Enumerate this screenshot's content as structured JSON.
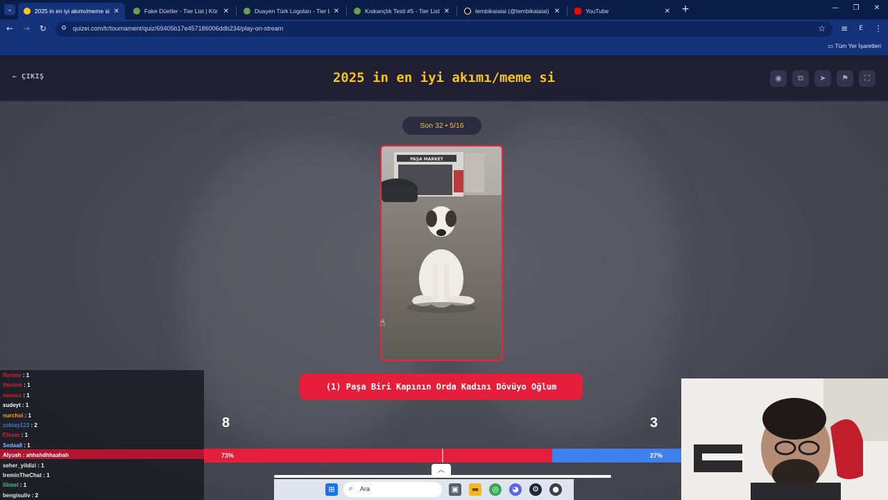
{
  "browser": {
    "tabs": [
      {
        "title": "2025 in en iyi akımı/meme si - ",
        "active": true,
        "favicon_color": "#f5c518"
      },
      {
        "title": "Fake Düetler - Tier List | Kör Sır",
        "active": false,
        "favicon_color": "#8fb3ff"
      },
      {
        "title": "Duayen Türk Logoları - Tier List",
        "active": false,
        "favicon_color": "#8fb3ff"
      },
      {
        "title": "Kıskançlık Testi #5 - Tier List, Kö",
        "active": false,
        "favicon_color": "#8fb3ff"
      },
      {
        "title": "tembikaiaiai (@tembikaiaiai) | T",
        "active": false,
        "favicon_color": "#111111"
      },
      {
        "title": "YouTube",
        "active": false,
        "favicon_color": "#ff0000"
      }
    ],
    "url": "quizei.com/tr/tournament/quiz/69405b17e457186006ddb234/play-on-stream",
    "bookmarks_all": "Tüm Yer İşaretleri",
    "profile_initial": "E"
  },
  "page": {
    "exit_label": "ÇIKIŞ",
    "title": "2025 in en iyi akımı/meme si",
    "round_label": "Son 32 • 5/16",
    "choice_label": "(1) Paşa Biri Kapının Orda Kadını Dövüyo Oğlum",
    "photo_sign": "PAŞA MARKET",
    "votes_left": "8",
    "votes_right": "3",
    "pct_left_label": "73%",
    "pct_right_label": "27%",
    "pct_left_value": 73,
    "colors": {
      "accent_yellow": "#f5c518",
      "vote_red": "#e51e3c",
      "vote_blue": "#3e80ec"
    }
  },
  "chat": [
    {
      "user": "fferiste",
      "text": " : 1",
      "color": "#d4232e"
    },
    {
      "user": "thisism",
      "text": " : 1",
      "color": "#d4232e"
    },
    {
      "user": "nscecs",
      "text": " : 1",
      "color": "#d4232e"
    },
    {
      "user": "sudeyt",
      "text": " : 1",
      "color": "#ffffff"
    },
    {
      "user": "nurchoi",
      "text": " : 1",
      "color": "#f0a21a"
    },
    {
      "user": "zoktay123",
      "text": " : 2",
      "color": "#3a7bd5"
    },
    {
      "user": "Efeser",
      "text": " : 1",
      "color": "#d4232e"
    },
    {
      "user": "Sedaa8",
      "text": " : 1",
      "color": "#8fb3ff"
    },
    {
      "user": "Alyush",
      "text": " : ahhahdhhaahah",
      "color": "#ffffff"
    },
    {
      "user": "seher_yildizi",
      "text": " : 1",
      "color": "#e8e8e8"
    },
    {
      "user": "IreminTheChat",
      "text": " : 1",
      "color": "#e8e8e8"
    },
    {
      "user": "lilimel",
      "text": " : 1",
      "color": "#2ecc71"
    },
    {
      "user": "bengisuliv",
      "text": " : 2",
      "color": "#e8e8e8"
    }
  ],
  "taskbar": {
    "search_label": "Ara"
  }
}
